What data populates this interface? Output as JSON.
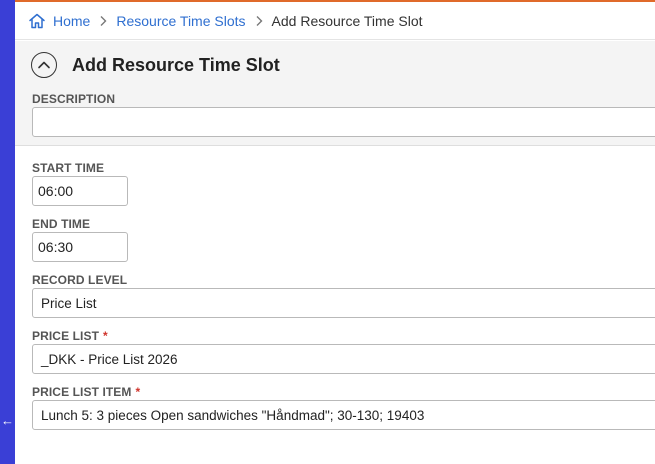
{
  "breadcrumb": {
    "home": "Home",
    "section": "Resource Time Slots",
    "current": "Add Resource Time Slot"
  },
  "panel": {
    "title": "Add Resource Time Slot",
    "description_label": "DESCRIPTION",
    "description_value": ""
  },
  "form": {
    "start_time_label": "START TIME",
    "start_time_value": "06:00",
    "end_time_label": "END TIME",
    "end_time_value": "06:30",
    "record_level_label": "RECORD LEVEL",
    "record_level_value": "Price List",
    "price_list_label": "PRICE LIST",
    "price_list_value": "_DKK - Price List 2026",
    "price_list_item_label": "PRICE LIST ITEM",
    "price_list_item_value": "Lunch 5: 3 pieces Open sandwiches \"Håndmad\"; 30-130; 19403",
    "required_marker": "*"
  },
  "colors": {
    "rail": "#3a3fd6",
    "accent": "#e06a2a",
    "link": "#2f6fd0",
    "required": "#d0342c"
  },
  "icons": [
    "home-icon",
    "chevron-right-icon",
    "chevron-up-circle-icon",
    "arrow-left-icon"
  ]
}
